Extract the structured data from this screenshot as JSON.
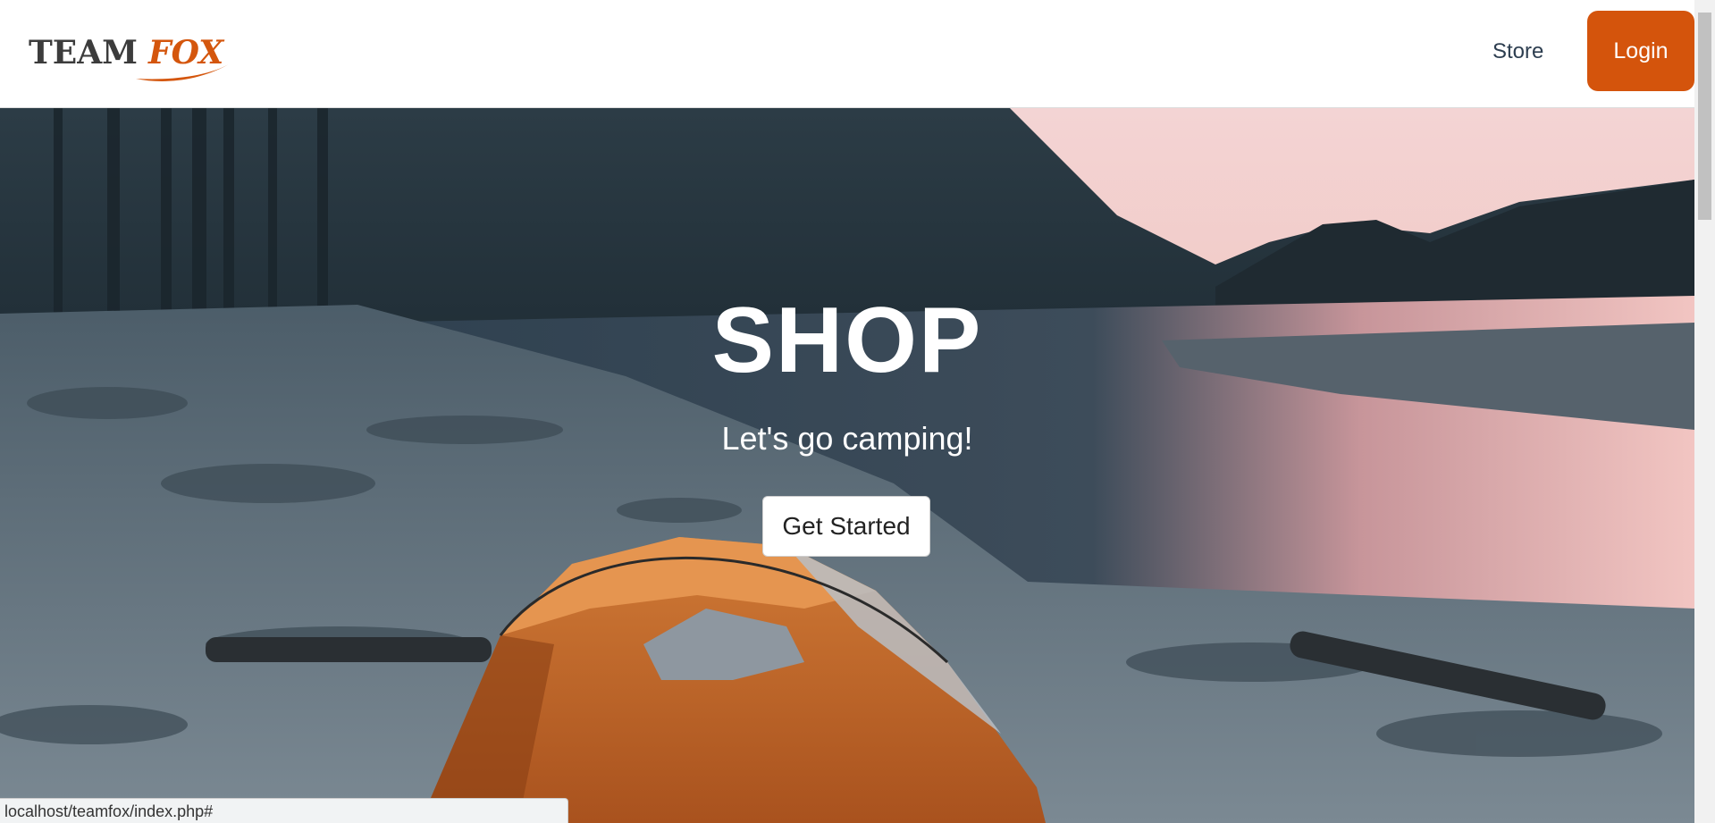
{
  "browser": {
    "status_url": "localhost/teamfox/index.php#"
  },
  "navbar": {
    "logo_team": "TEAM",
    "logo_fox": "FOX",
    "store_label": "Store",
    "login_label": "Login"
  },
  "hero": {
    "title": "SHOP",
    "subtitle": "Let's go camping!",
    "cta_label": "Get Started"
  },
  "colors": {
    "accent": "#d4540c",
    "nav_text": "#2d3e50",
    "logo_dark": "#3c3c3c"
  },
  "icons": {
    "logo": "team-fox-logo",
    "background": "campsite-lake-photo"
  }
}
